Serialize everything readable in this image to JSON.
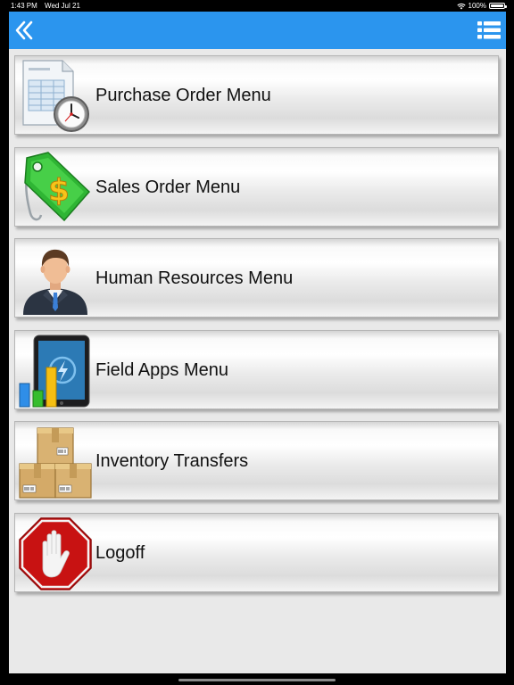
{
  "status_bar": {
    "time": "1:43 PM",
    "date": "Wed Jul 21",
    "battery": "100%"
  },
  "nav": {
    "back_icon": "double-chevron-left-icon",
    "menu_icon": "list-icon",
    "accent_color": "#2b95ee"
  },
  "menu": {
    "items": [
      {
        "label": "Purchase Order Menu",
        "icon": "purchase-order-icon"
      },
      {
        "label": "Sales Order Menu",
        "icon": "dollar-tag-icon"
      },
      {
        "label": "Human Resources Menu",
        "icon": "businessman-icon"
      },
      {
        "label": "Field Apps Menu",
        "icon": "tablet-chart-icon"
      },
      {
        "label": "Inventory Transfers",
        "icon": "boxes-icon"
      },
      {
        "label": "Logoff",
        "icon": "stop-hand-icon"
      }
    ]
  }
}
